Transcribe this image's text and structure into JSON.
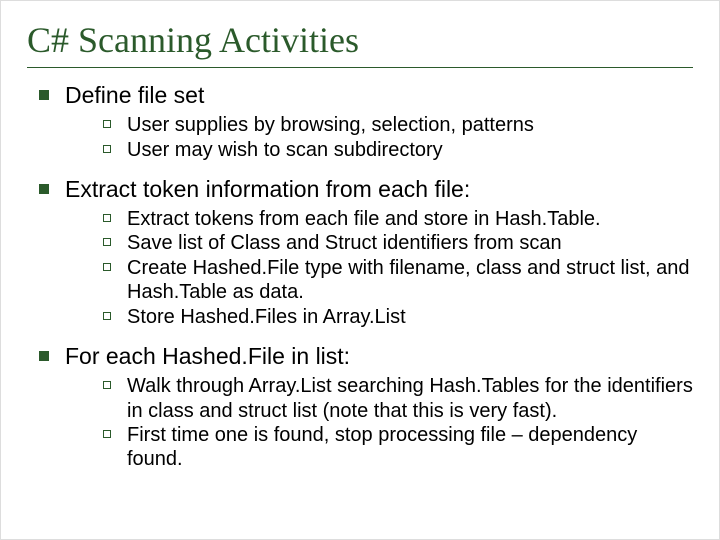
{
  "title": "C# Scanning Activities",
  "sections": [
    {
      "heading": "Define file set",
      "items": [
        "User supplies by browsing, selection, patterns",
        "User may wish to scan subdirectory"
      ]
    },
    {
      "heading": "Extract token information from each file:",
      "items": [
        "Extract tokens from each file and store in Hash.Table.",
        "Save list of Class and Struct identifiers from scan",
        "Create Hashed.File type with filename, class and struct list, and Hash.Table as data.",
        "Store Hashed.Files in Array.List"
      ]
    },
    {
      "heading": "For each Hashed.File in list:",
      "items": [
        "Walk through Array.List searching Hash.Tables for the identifiers in class and struct list (note that this is very fast).",
        "First time one is found, stop processing file – dependency found."
      ]
    }
  ]
}
